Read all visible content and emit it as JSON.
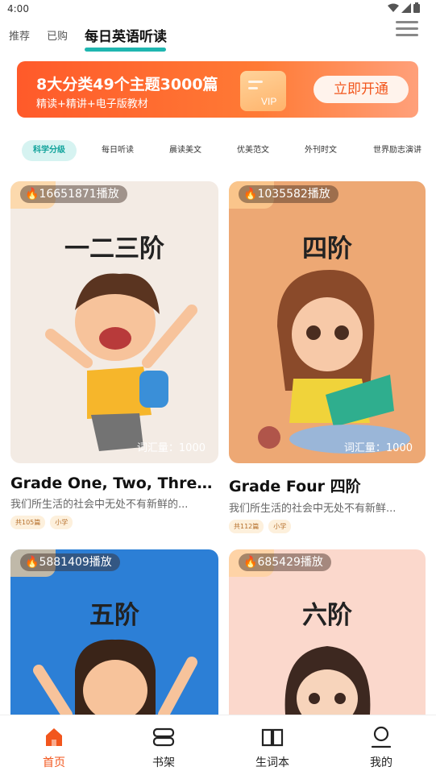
{
  "status": {
    "time": "4:00"
  },
  "nav": {
    "tabs": [
      "推荐",
      "已购",
      "每日英语听读"
    ],
    "active_index": 2
  },
  "banner": {
    "title": "8大分类49个主题3000篇",
    "subtitle": "精读+精讲+电子版教材",
    "vip_label": "VIP",
    "button": "立即开通"
  },
  "categories": [
    "科学分级",
    "每日听读",
    "晨读美文",
    "优美范文",
    "外刊时文",
    "世界励志演讲"
  ],
  "cards": [
    {
      "plays": "16651871播放",
      "grade": "一二三阶",
      "vocab": "词汇量：1000",
      "title": "Grade One, Two, Three ...",
      "desc": "我们所生活的社会中无处不有新鲜的...",
      "tags": [
        "共105篇",
        "小学"
      ],
      "bg": "#f3ebe4"
    },
    {
      "plays": "1035582播放",
      "grade": "四阶",
      "vocab": "词汇量：1000",
      "title": "Grade Four 四阶",
      "desc": "我们所生活的社会中无处不有新鲜...",
      "tags": [
        "共112篇",
        "小学"
      ],
      "bg": "#eda874"
    },
    {
      "plays": "5881409播放",
      "grade": "五阶",
      "vocab": "",
      "title": "",
      "desc": "",
      "tags": [],
      "bg": "#2c7fd6"
    },
    {
      "plays": "685429播放",
      "grade": "六阶",
      "vocab": "",
      "title": "",
      "desc": "",
      "tags": [],
      "bg": "#fbd8cc"
    }
  ],
  "tabbar": [
    {
      "label": "首页",
      "icon": "home-icon",
      "active": true
    },
    {
      "label": "书架",
      "icon": "bookshelf-icon",
      "active": false
    },
    {
      "label": "生词本",
      "icon": "book-icon",
      "active": false
    },
    {
      "label": "我的",
      "icon": "profile-icon",
      "active": false
    }
  ],
  "colors": {
    "accent": "#1fb6b0",
    "brand": "#f2561d"
  }
}
